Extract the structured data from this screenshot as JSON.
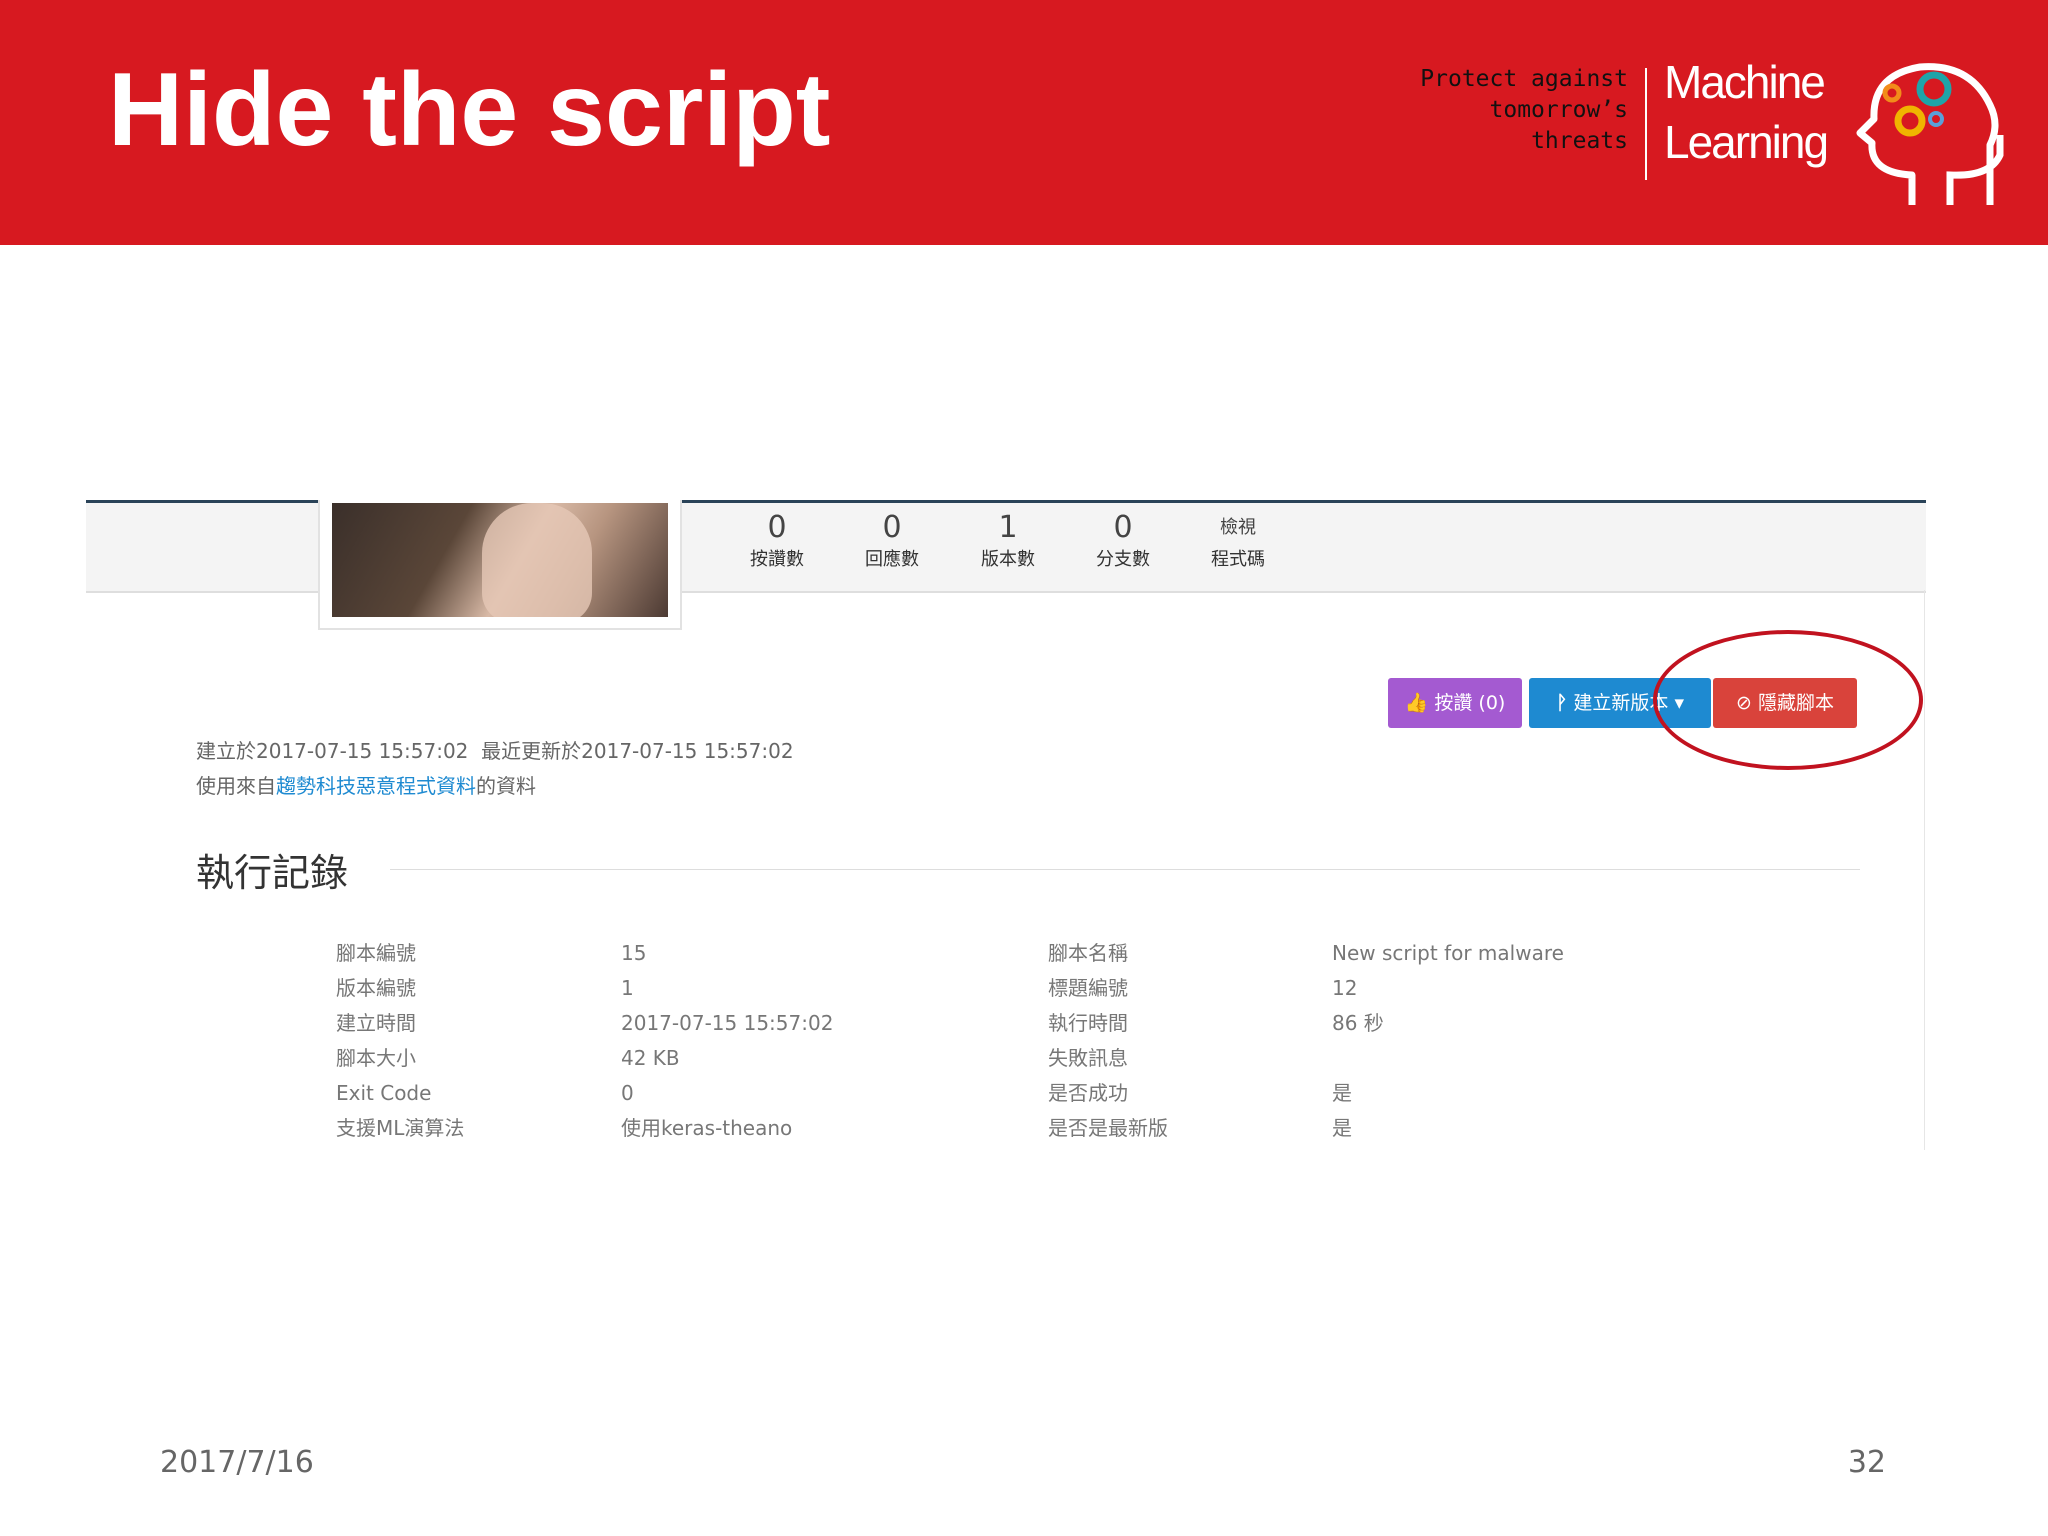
{
  "slide": {
    "title": "Hide the script",
    "tagline": [
      "Protect against",
      "tomorrow’s",
      "threats"
    ],
    "brand_line1": "Machine",
    "brand_line2": "Learning",
    "footer_date": "2017/7/16",
    "page_number": "32"
  },
  "stats": [
    {
      "value": "0",
      "label": "按讚數"
    },
    {
      "value": "0",
      "label": "回應數"
    },
    {
      "value": "1",
      "label": "版本數"
    },
    {
      "value": "0",
      "label": "分支數"
    },
    {
      "value": "檢視",
      "label": "程式碼"
    }
  ],
  "buttons": {
    "like": "按讚 (0)",
    "new_version": "建立新版本",
    "hide": "隱藏腳本"
  },
  "meta": {
    "created_prefix": "建立於2017-07-15 15:57:02",
    "updated_prefix": "最近更新於2017-07-15 15:57:02",
    "source_prefix": "使用來自",
    "source_link": "趨勢科技惡意程式資料",
    "source_suffix": "的資料"
  },
  "section": {
    "title": "執行記錄"
  },
  "info_rows": [
    {
      "k1": "腳本編號",
      "v1": "15",
      "k2": "腳本名稱",
      "v2": "New script for malware"
    },
    {
      "k1": "版本編號",
      "v1": "1",
      "k2": "標題編號",
      "v2": "12"
    },
    {
      "k1": "建立時間",
      "v1": "2017-07-15 15:57:02",
      "k2": "執行時間",
      "v2": "86 秒"
    },
    {
      "k1": "腳本大小",
      "v1": "42 KB",
      "k2": "失敗訊息",
      "v2": ""
    },
    {
      "k1": "Exit Code",
      "v1": "0",
      "k2": "是否成功",
      "v2": "是"
    },
    {
      "k1": "支援ML演算法",
      "v1": "使用keras-theano",
      "k2": "是否是最新版",
      "v2": "是"
    }
  ],
  "colors": {
    "banner": "#d71920",
    "like_button": "#a45ad1",
    "version_button": "#1e8ad1",
    "hide_button": "#d9433b",
    "highlight": "#c1121f"
  },
  "icons": {
    "like": "thumbs-up-icon",
    "version": "branch-icon",
    "caret": "caret-down-icon",
    "hide": "ban-icon",
    "logo": "head-gears-icon"
  }
}
